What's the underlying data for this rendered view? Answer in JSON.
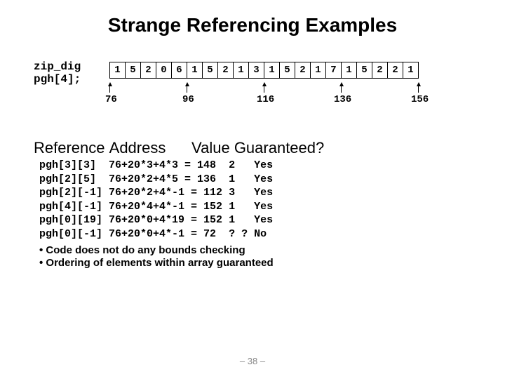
{
  "title": "Strange Referencing Examples",
  "decl": {
    "l1": "zip_dig",
    "l2": "pgh[4];"
  },
  "cells": [
    "1",
    "5",
    "2",
    "0",
    "6",
    "1",
    "5",
    "2",
    "1",
    "3",
    "1",
    "5",
    "2",
    "1",
    "7",
    "1",
    "5",
    "2",
    "2",
    "1"
  ],
  "ptrs": [
    "76",
    "96",
    "116",
    "136",
    "156"
  ],
  "hdr": {
    "ref": "Reference",
    "addr": "Address",
    "val": "Value",
    "g": "Guaranteed?"
  },
  "rows": [
    {
      "r": "pgh[3][3]  ",
      "a": "76+20*3+4*3 = 148  ",
      "v": "2   ",
      "g": "Yes"
    },
    {
      "r": "pgh[2][5]  ",
      "a": "76+20*2+4*5 = 136  ",
      "v": "1   ",
      "g": "Yes"
    },
    {
      "r": "pgh[2][-1] ",
      "a": "76+20*2+4*-1 = 112 ",
      "v": "3   ",
      "g": "Yes"
    },
    {
      "r": "pgh[4][-1] ",
      "a": "76+20*4+4*-1 = 152 ",
      "v": "1   ",
      "g": "Yes"
    },
    {
      "r": "pgh[0][19] ",
      "a": "76+20*0+4*19 = 152 ",
      "v": "1   ",
      "g": "Yes"
    },
    {
      "r": "pgh[0][-1] ",
      "a": "76+20*0+4*-1 = 72  ",
      "v": "? ? ",
      "g": "No"
    }
  ],
  "bul1": "•  Code does not do any bounds checking",
  "bul2": "•  Ordering of elements within array guaranteed",
  "pgnum": "– 38 –"
}
